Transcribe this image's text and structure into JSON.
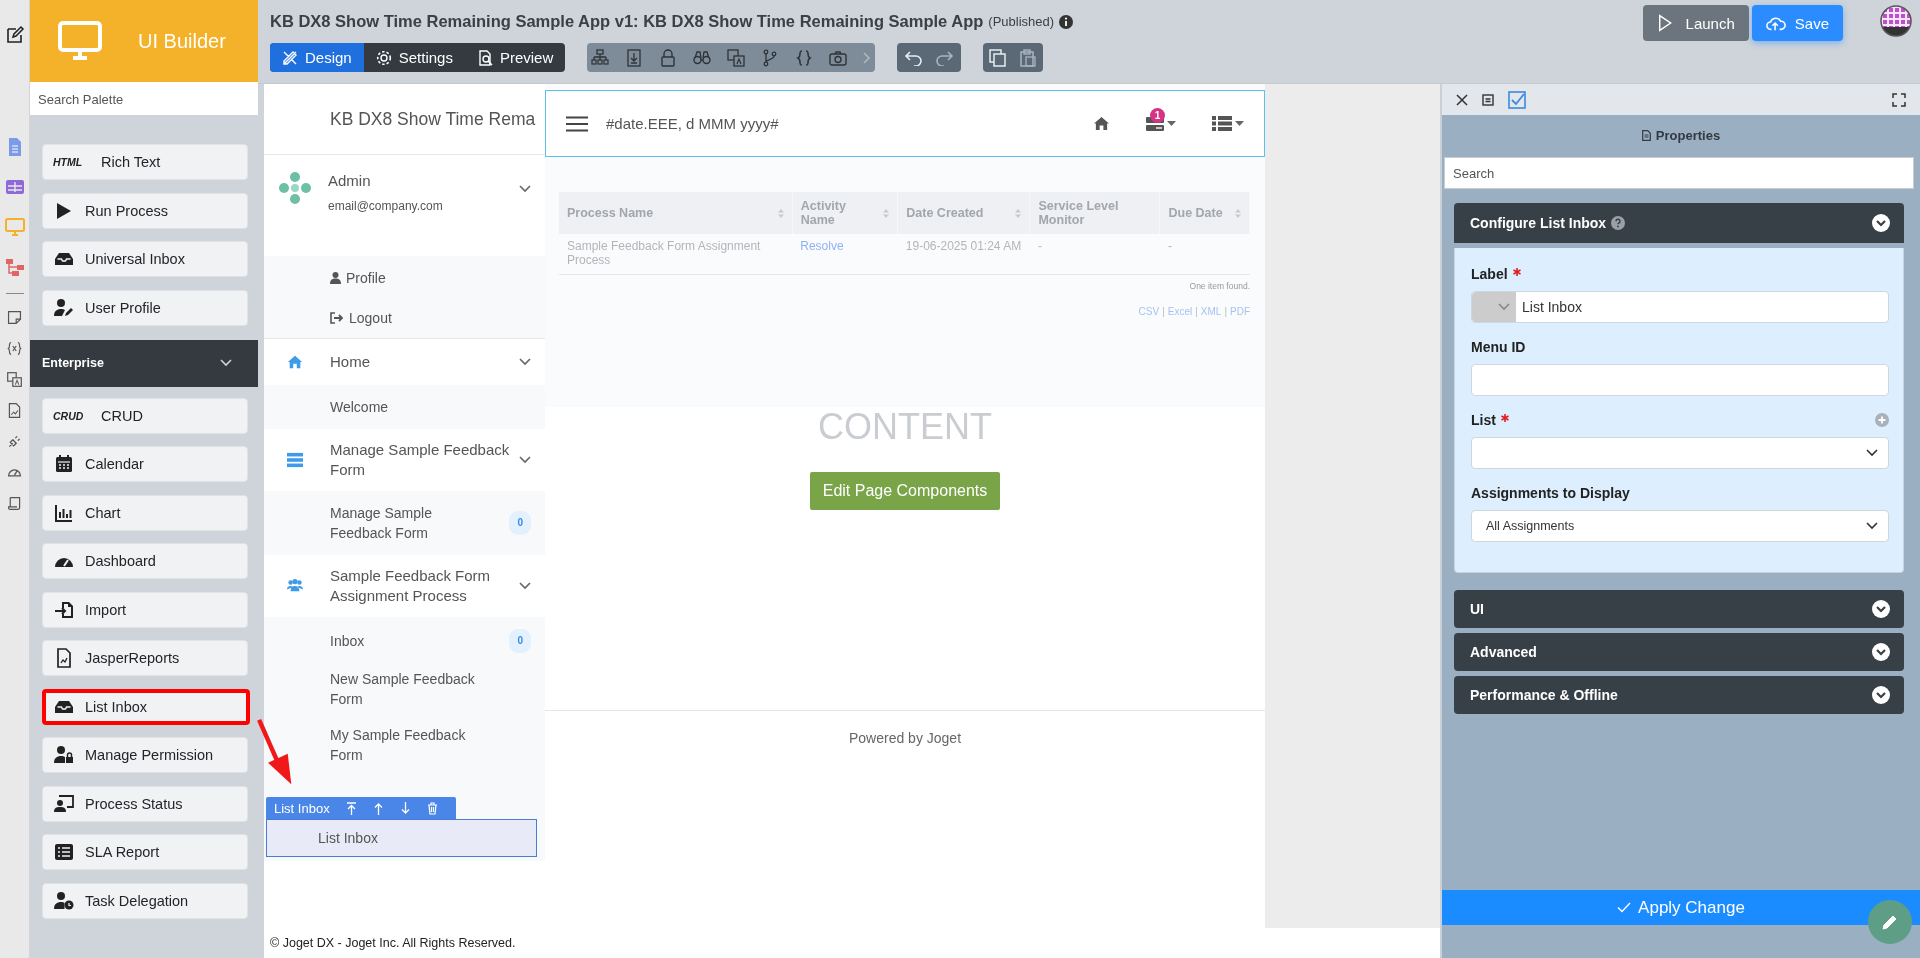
{
  "builder": {
    "title": "UI Builder"
  },
  "topbar": {
    "app_title": "KB DX8 Show Time Remaining Sample App v1: KB DX8 Show Time Remaining Sample App",
    "status": "(Published)",
    "mode_tabs": [
      {
        "label": "Design",
        "selected": true
      },
      {
        "label": "Settings",
        "selected": false
      },
      {
        "label": "Preview",
        "selected": false
      }
    ],
    "actions": [
      {
        "label": "Launch",
        "kind": "secondary"
      },
      {
        "label": "Save",
        "kind": "primary"
      }
    ]
  },
  "palette": {
    "search_placeholder": "Search Palette",
    "items": [
      {
        "label": "Rich Text",
        "icon_text": "HTML"
      },
      {
        "label": "Run Process"
      },
      {
        "label": "Universal Inbox"
      },
      {
        "label": "User Profile"
      }
    ],
    "section": {
      "title": "Enterprise",
      "expanded": true
    },
    "enterprise_items": [
      {
        "label": "CRUD",
        "icon_text": "CRUD",
        "highlighted": false
      },
      {
        "label": "Calendar",
        "highlighted": false
      },
      {
        "label": "Chart",
        "highlighted": false
      },
      {
        "label": "Dashboard",
        "highlighted": false
      },
      {
        "label": "Import",
        "highlighted": false
      },
      {
        "label": "JasperReports",
        "highlighted": false
      },
      {
        "label": "List Inbox",
        "highlighted": true
      },
      {
        "label": "Manage Permission",
        "highlighted": false
      },
      {
        "label": "Process Status",
        "highlighted": false
      },
      {
        "label": "SLA Report",
        "highlighted": false
      },
      {
        "label": "Task Delegation",
        "highlighted": false
      }
    ]
  },
  "menu": {
    "brand": "KB DX8 Show Time Rema",
    "user": {
      "name": "Admin",
      "email": "email@company.com",
      "expanded": true
    },
    "user_links": [
      "Profile",
      "Logout"
    ],
    "categories": [
      {
        "label": "Home",
        "expanded": true,
        "items": [
          {
            "label": "Welcome",
            "selected": false
          }
        ]
      },
      {
        "label": "Manage Sample Feedback Form",
        "expanded": true,
        "items": [
          {
            "label": "Manage Sample Feedback Form",
            "badge": "0",
            "selected": false
          }
        ]
      },
      {
        "label": "Sample Feedback Form Assignment Process",
        "expanded": true,
        "items": [
          {
            "label": "Inbox",
            "badge": "0",
            "selected": false
          },
          {
            "label": "New Sample Feedback Form",
            "selected": false
          },
          {
            "label": "My Sample Feedback Form",
            "selected": false
          },
          {
            "label": "List Inbox",
            "selected": true
          }
        ]
      }
    ],
    "selection_toolbar": {
      "label": "List Inbox"
    }
  },
  "header": {
    "date_text": "#date.EEE, d MMM yyyy#",
    "notification_count": "1"
  },
  "table": {
    "columns": [
      {
        "label": "Process Name",
        "sortable": true
      },
      {
        "label": "Activity Name",
        "sortable": true
      },
      {
        "label": "Date Created",
        "sortable": true
      },
      {
        "label": "Service Level Monitor",
        "sortable": false
      },
      {
        "label": "Due Date",
        "sortable": true
      }
    ],
    "rows": [
      [
        "Sample Feedback Form Assignment Process",
        "Resolve",
        "19-06-2025 01:24 AM",
        "-",
        "-"
      ]
    ],
    "footer": "One item found.",
    "exports": [
      "CSV",
      "Excel",
      "XML",
      "PDF"
    ],
    "export_separator": "|"
  },
  "content": {
    "placeholder_title": "CONTENT",
    "edit_button": "Edit Page Components",
    "powered_by": "Powered by Joget"
  },
  "copyright": "© Joget DX - Joget Inc. All Rights Reserved.",
  "properties": {
    "title": "Properties",
    "search_placeholder": "Search",
    "sections": [
      {
        "title": "Configure List Inbox",
        "expanded": true,
        "fields": [
          {
            "kind": "label-input",
            "label": "Label",
            "required": true,
            "value": "List Inbox"
          },
          {
            "kind": "text",
            "label": "Menu ID",
            "required": false
          },
          {
            "kind": "select",
            "label": "List",
            "required": true,
            "addable": true
          },
          {
            "kind": "select",
            "label": "Assignments to Display",
            "required": false,
            "value": "All Assignments"
          }
        ]
      },
      {
        "title": "UI",
        "expanded": false
      },
      {
        "title": "Advanced",
        "expanded": false
      },
      {
        "title": "Performance & Offline",
        "expanded": false
      }
    ],
    "apply_button": "Apply Change"
  }
}
